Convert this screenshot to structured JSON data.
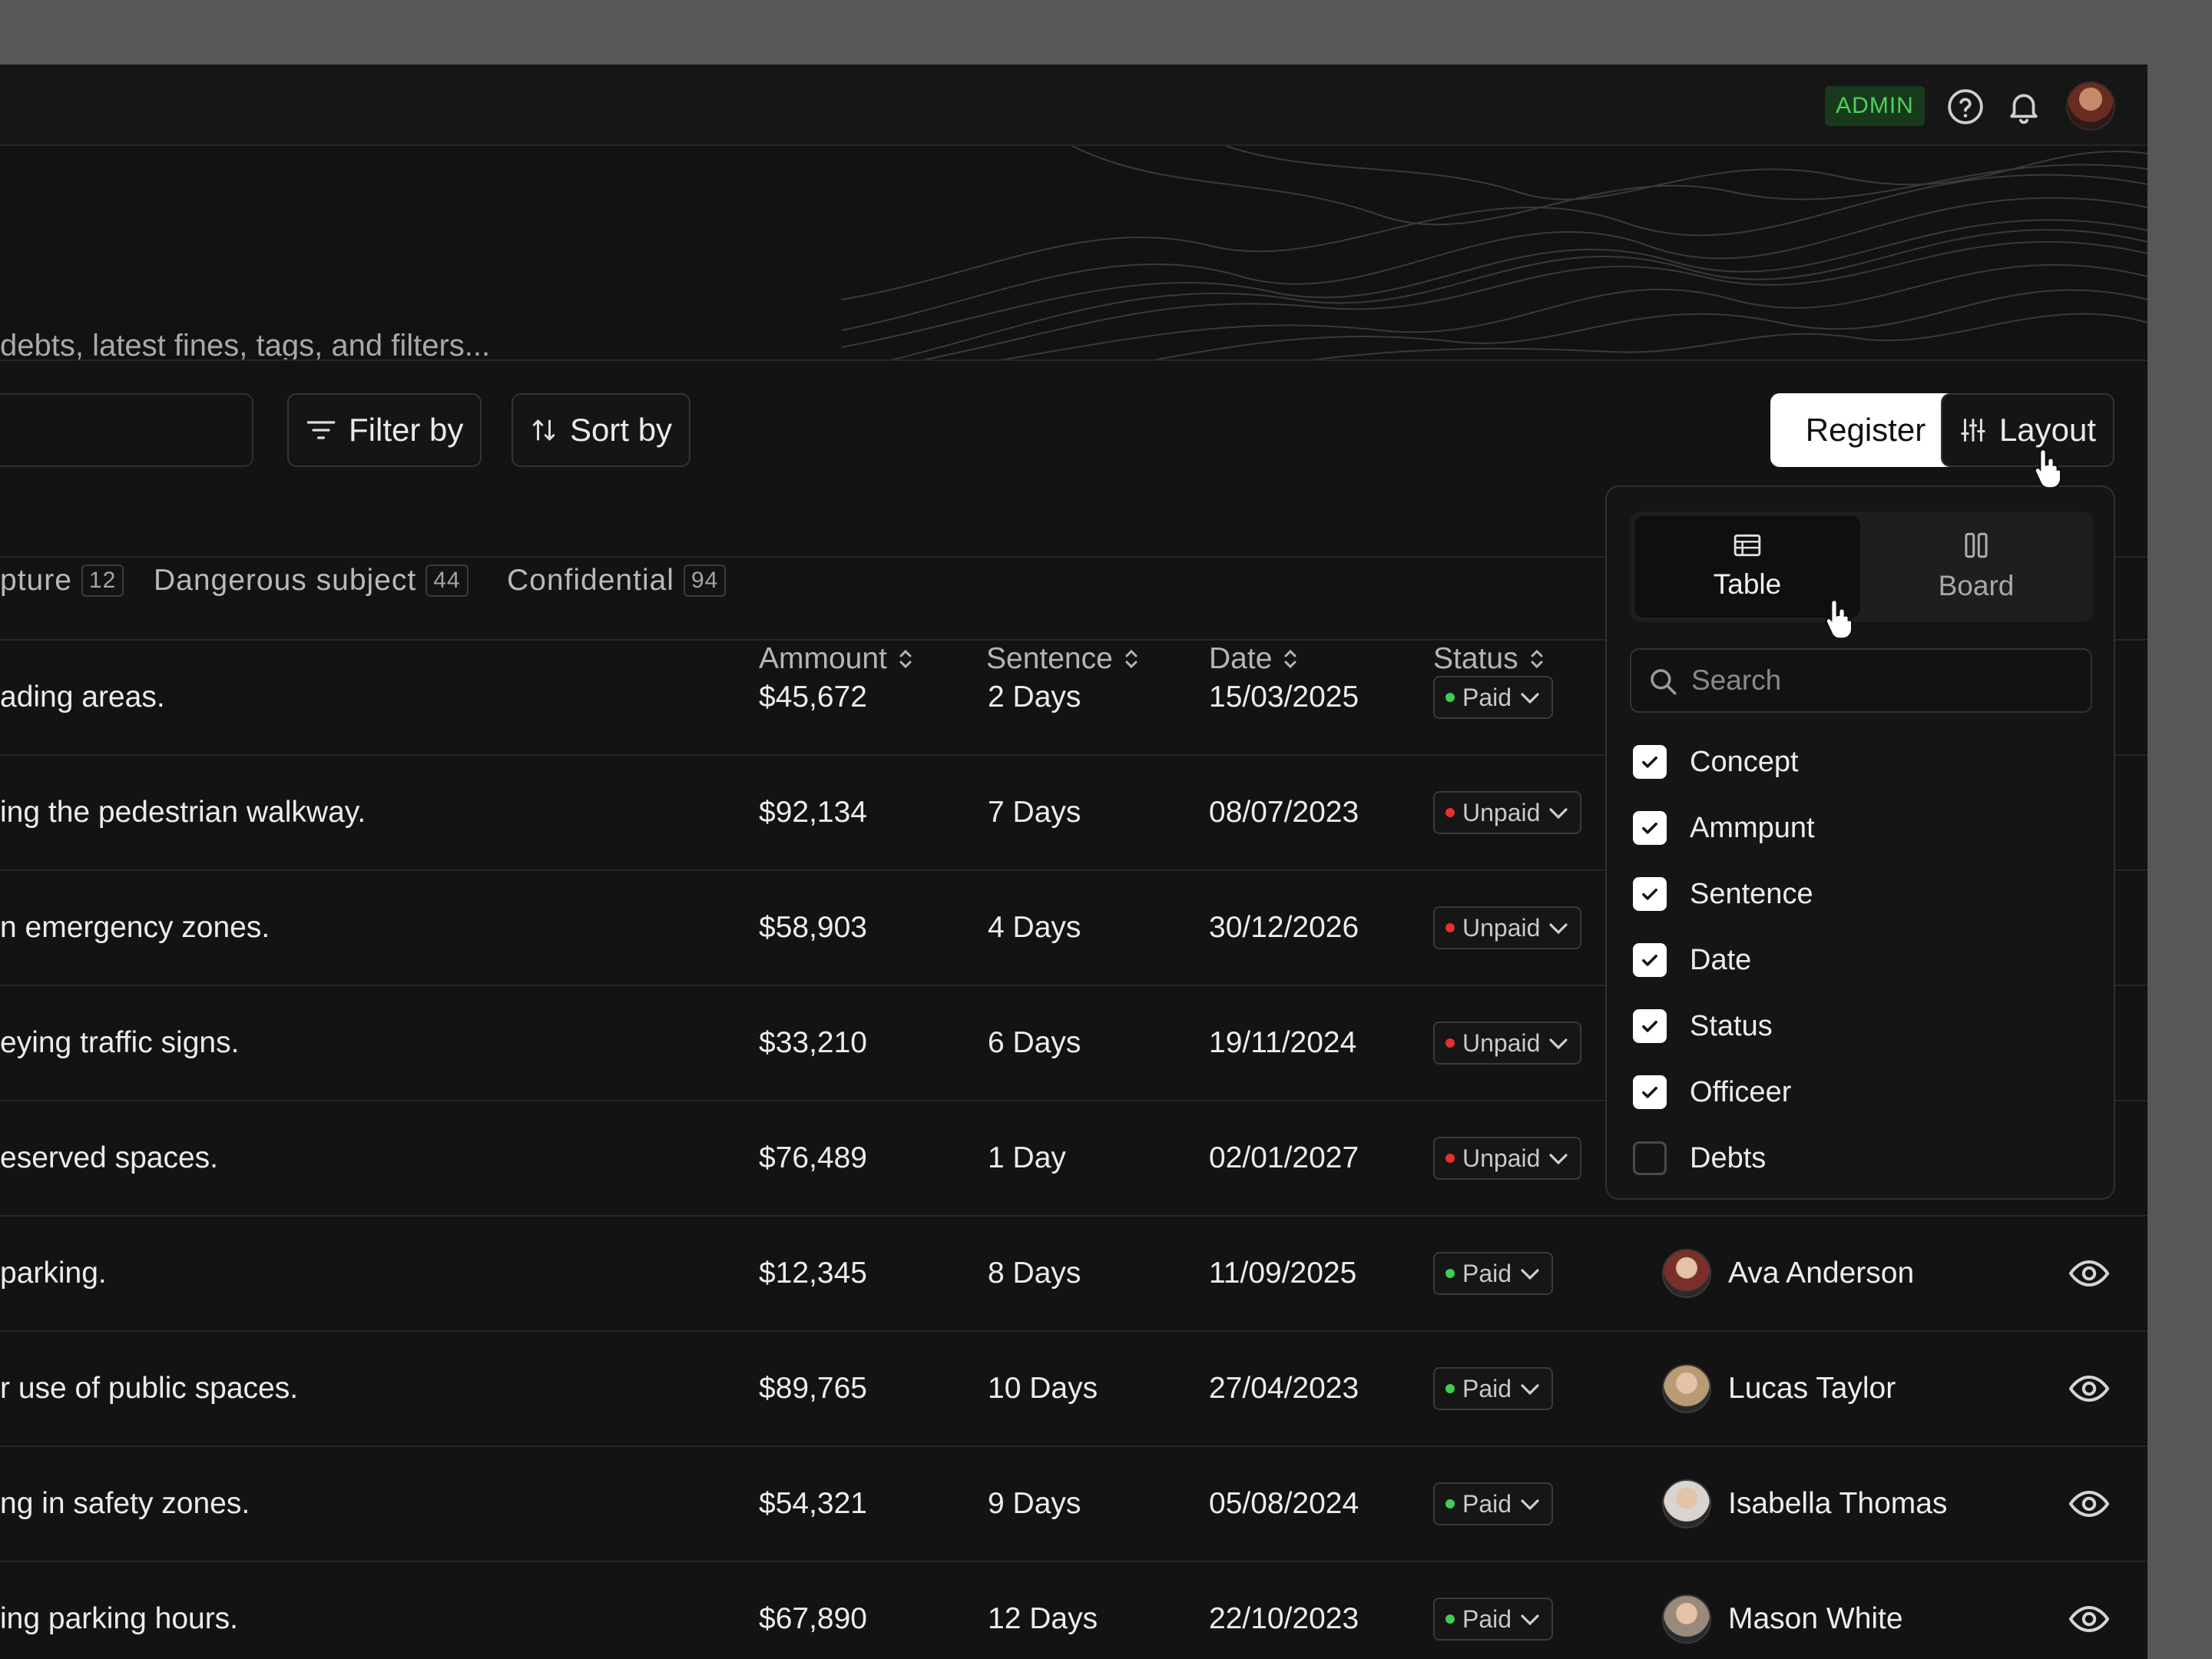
{
  "header": {
    "role_badge": "ADMIN",
    "icons": [
      "help-icon",
      "bell-icon",
      "user-avatar"
    ]
  },
  "hero": {
    "subtitle": "debts, latest fines, tags, and filters..."
  },
  "toolbar": {
    "filter_label": "Filter by",
    "sort_label": "Sort by",
    "register_label": "Register",
    "layout_label": "Layout"
  },
  "tags": [
    {
      "label": "pture",
      "count": "12"
    },
    {
      "label": "Dangerous subject",
      "count": "44"
    },
    {
      "label": "Confidential",
      "count": "94"
    }
  ],
  "table": {
    "columns": {
      "amount": "Ammount",
      "sentence": "Sentence",
      "date": "Date",
      "status": "Status"
    },
    "rows": [
      {
        "concept": "ading areas.",
        "amount": "$45,672",
        "sentence": "2 Days",
        "date": "15/03/2025",
        "status": "Paid",
        "officer": "",
        "avatar_color": ""
      },
      {
        "concept": "ing the pedestrian walkway.",
        "amount": "$92,134",
        "sentence": "7 Days",
        "date": "08/07/2023",
        "status": "Unpaid",
        "officer": "",
        "avatar_color": ""
      },
      {
        "concept": "n emergency zones.",
        "amount": "$58,903",
        "sentence": "4 Days",
        "date": "30/12/2026",
        "status": "Unpaid",
        "officer": "",
        "avatar_color": ""
      },
      {
        "concept": "eying traffic signs.",
        "amount": "$33,210",
        "sentence": "6 Days",
        "date": "19/11/2024",
        "status": "Unpaid",
        "officer": "",
        "avatar_color": ""
      },
      {
        "concept": "eserved spaces.",
        "amount": "$76,489",
        "sentence": "1 Day",
        "date": "02/01/2027",
        "status": "Unpaid",
        "officer": "",
        "avatar_color": ""
      },
      {
        "concept": "parking.",
        "amount": "$12,345",
        "sentence": "8 Days",
        "date": "11/09/2025",
        "status": "Paid",
        "officer": "Ava Anderson",
        "avatar_color": "#7a2f2a"
      },
      {
        "concept": "r use of public spaces.",
        "amount": "$89,765",
        "sentence": "10 Days",
        "date": "27/04/2023",
        "status": "Paid",
        "officer": "Lucas Taylor",
        "avatar_color": "#b99a72"
      },
      {
        "concept": "ng in safety zones.",
        "amount": "$54,321",
        "sentence": "9 Days",
        "date": "05/08/2024",
        "status": "Paid",
        "officer": "Isabella Thomas",
        "avatar_color": "#d9d4cf"
      },
      {
        "concept": "ing parking hours.",
        "amount": "$67,890",
        "sentence": "12 Days",
        "date": "22/10/2023",
        "status": "Paid",
        "officer": "Mason White",
        "avatar_color": "#9a8a7a"
      }
    ]
  },
  "layout_panel": {
    "views": [
      {
        "label": "Table",
        "active": true
      },
      {
        "label": "Board",
        "active": false
      }
    ],
    "search_placeholder": "Search",
    "options": [
      {
        "label": "Concept",
        "checked": true
      },
      {
        "label": "Ammpunt",
        "checked": true
      },
      {
        "label": "Sentence",
        "checked": true
      },
      {
        "label": "Date",
        "checked": true
      },
      {
        "label": "Status",
        "checked": true
      },
      {
        "label": "Officeer",
        "checked": true
      },
      {
        "label": "Debts",
        "checked": false
      }
    ]
  },
  "colors": {
    "paid": "#3ecf4f",
    "unpaid": "#e5302d",
    "admin_bg": "#183a1c",
    "admin_text": "#4fd15c"
  }
}
